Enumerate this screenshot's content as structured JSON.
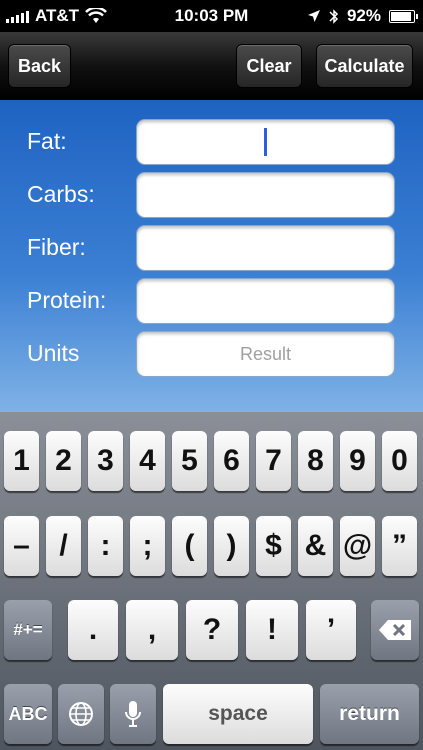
{
  "status_bar": {
    "carrier": "AT&T",
    "time": "10:03 PM",
    "battery": "92%",
    "battery_level": 0.92,
    "icons": [
      "signal-icon",
      "wifi-icon",
      "location-icon",
      "bluetooth-icon",
      "battery-icon"
    ]
  },
  "toolbar": {
    "back_label": "Back",
    "clear_label": "Clear",
    "calculate_label": "Calculate"
  },
  "form": {
    "fields": [
      {
        "label": "Fat:",
        "value": "",
        "placeholder": ""
      },
      {
        "label": "Carbs:",
        "value": "",
        "placeholder": ""
      },
      {
        "label": "Fiber:",
        "value": "",
        "placeholder": ""
      },
      {
        "label": "Protein:",
        "value": "",
        "placeholder": ""
      },
      {
        "label": "Units",
        "value": "",
        "placeholder": "Result"
      }
    ]
  },
  "keyboard": {
    "row1": [
      "1",
      "2",
      "3",
      "4",
      "5",
      "6",
      "7",
      "8",
      "9",
      "0"
    ],
    "row2": [
      "–",
      "/",
      ":",
      ";",
      "(",
      ")",
      "$",
      "&",
      "@",
      "”"
    ],
    "row3_mode": "#+=",
    "row3": [
      ".",
      ",",
      "?",
      "!",
      "’"
    ],
    "abc_label": "ABC",
    "space_label": "space",
    "return_label": "return",
    "icons": [
      "delete-icon",
      "globe-icon",
      "microphone-icon"
    ]
  },
  "colors": {
    "form_blue": "#2f6fd0",
    "caret": "#2f5de0"
  }
}
